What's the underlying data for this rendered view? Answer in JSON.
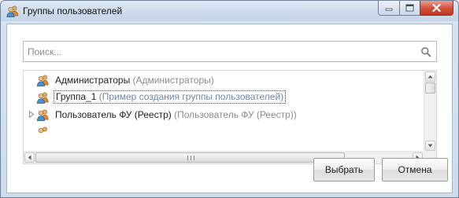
{
  "window": {
    "title": "Группы пользователей"
  },
  "search": {
    "placeholder": "Поиск..."
  },
  "tree": {
    "items": [
      {
        "name": "Администраторы",
        "description": "(Администраторы)",
        "selected": false,
        "expandable": false
      },
      {
        "name": "Группа_1",
        "description": "(Пример создания группы пользователей)",
        "selected": true,
        "expandable": false
      },
      {
        "name": "Пользователь ФУ (Реестр)",
        "description": "(Пользователь ФУ (Реестр))",
        "selected": false,
        "expandable": true
      }
    ]
  },
  "buttons": {
    "ok_label": "Выбрать",
    "cancel_label": "Отмена"
  },
  "colors": {
    "accent": "#6f87a8",
    "description_text": "#8b8b8b",
    "close_button": "#c0351f"
  },
  "icons": {
    "title": "user-group-icon",
    "row": "user-group-icon",
    "search": "search-icon"
  }
}
